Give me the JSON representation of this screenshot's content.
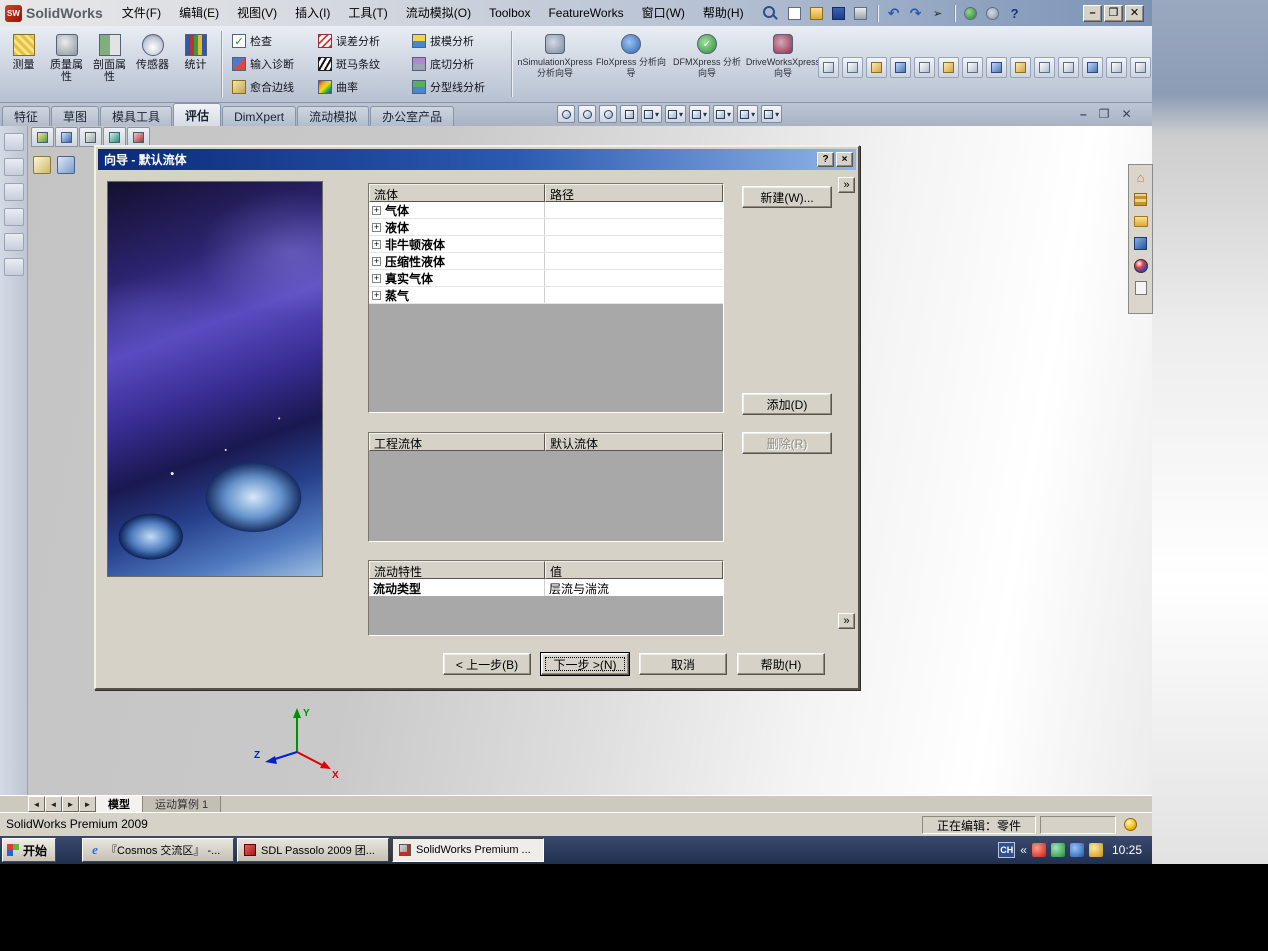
{
  "icons": {
    "minimize": "–",
    "restore": "❐",
    "close": "✕",
    "help": "?",
    "dialog_help": "?",
    "dialog_close": "×",
    "chevron": "»",
    "plus": "+",
    "arrow_left": "◄",
    "arrow_right": "►",
    "tray_left": "«"
  },
  "app": {
    "logo_text": "SolidWorks",
    "menus": [
      "文件(F)",
      "编辑(E)",
      "视图(V)",
      "插入(I)",
      "工具(T)",
      "流动模拟(O)",
      "Toolbox",
      "FeatureWorks",
      "窗口(W)",
      "帮助(H)"
    ]
  },
  "ribbon": {
    "measure": "测量",
    "mass_properties": "质量属性",
    "section_properties": "剖面属性",
    "sensor": "传感器",
    "statistics": "统计",
    "check": "检查",
    "import_diagnostics": "输入诊断",
    "heal_edges": "愈合边线",
    "deviation_analysis": "误差分析",
    "zebra_stripes": "斑马条纹",
    "curvature": "曲率",
    "draft_analysis": "拔模分析",
    "undercut_analysis": "底切分析",
    "parting_line_analysis": "分型线分析",
    "simulationxpress": "nSimulationXpress 分析向导",
    "floxpress": "FloXpress 分析向导",
    "dfmxpress": "DFMXpress 分析向导",
    "driveworksxpress": "DriveWorksXpress 向导"
  },
  "tabs": [
    "特征",
    "草图",
    "模具工具",
    "评估",
    "DimXpert",
    "流动模拟",
    "办公室产品"
  ],
  "dialog": {
    "title": "向导 - 默认流体",
    "fluids_table": {
      "headers": [
        "流体",
        "路径"
      ],
      "rows": [
        "气体",
        "液体",
        "非牛顿液体",
        "压缩性液体",
        "真实气体",
        "蒸气"
      ]
    },
    "buttons": {
      "new": "新建(W)...",
      "add": "添加(D)",
      "remove": "删除(R)"
    },
    "project_table": {
      "headers": [
        "工程流体",
        "默认流体"
      ]
    },
    "properties_table": {
      "headers": [
        "流动特性",
        "值"
      ],
      "row_name": "流动类型",
      "row_value": "层流与湍流"
    },
    "nav": {
      "back": "< 上一步(B)",
      "next": "下一步 >(N)",
      "cancel": "取消",
      "help": "帮助(H)"
    }
  },
  "bottom_tabs": [
    "模型",
    "运动算例 1"
  ],
  "statusbar": {
    "left": "SolidWorks Premium 2009",
    "editing": "正在编辑：零件"
  },
  "taskbar": {
    "start": "开始",
    "tasks": [
      "『Cosmos 交流区』 -...",
      "SDL Passolo 2009 团...",
      "SolidWorks Premium ..."
    ],
    "tray_lang": "CH",
    "time": "10:25"
  }
}
